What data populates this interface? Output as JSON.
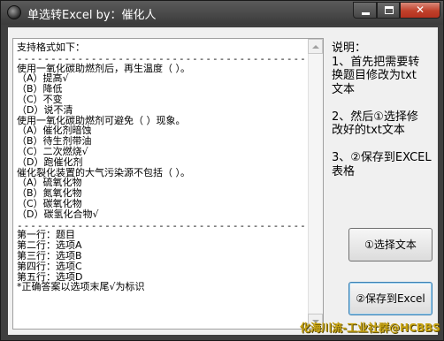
{
  "window": {
    "title": "单选转Excel by：催化人",
    "controls": {
      "minimize": "minimize",
      "maximize": "maximize",
      "close": "close"
    },
    "close_glyph": "✕"
  },
  "editor": {
    "lines": [
      "支持格式如下：",
      "-------------------------------------------",
      "使用一氧化碳助燃剂后，再生温度（    ）。",
      "（A）提高√",
      "（B）降低",
      "（C）不变",
      "（D）说不清",
      "使用一氧化碳助燃剂可避免（    ）现象。",
      "（A）催化剂暗蚀",
      "（B）待生剂带油",
      "（C）二次燃烧√",
      "（D）跑催化剂",
      "催化裂化装置的大气污染源不包括（    ）。",
      "（A）硫氧化物",
      "（B）氮氧化物",
      "（C）碳氧化物",
      "（D）碳氢化合物√",
      "-------------------------------------------",
      "第一行：题目",
      "第二行：选项A",
      "第三行：选项B",
      "第四行：选项C",
      "第五行：选项D",
      "*正确答案以选项末尾√为标识"
    ]
  },
  "instructions": {
    "lines": [
      "说明：",
      "1、首先把需要转",
      "换题目修改为txt",
      "文本",
      "",
      "2、然后①选择修",
      "改好的txt文本",
      "",
      "3、②保存到EXCEL",
      "表格"
    ]
  },
  "buttons": {
    "select_text": "①选择文本",
    "save_excel": "②保存到Excel"
  },
  "watermark": "化海川流-工业社群@HCBBS"
}
